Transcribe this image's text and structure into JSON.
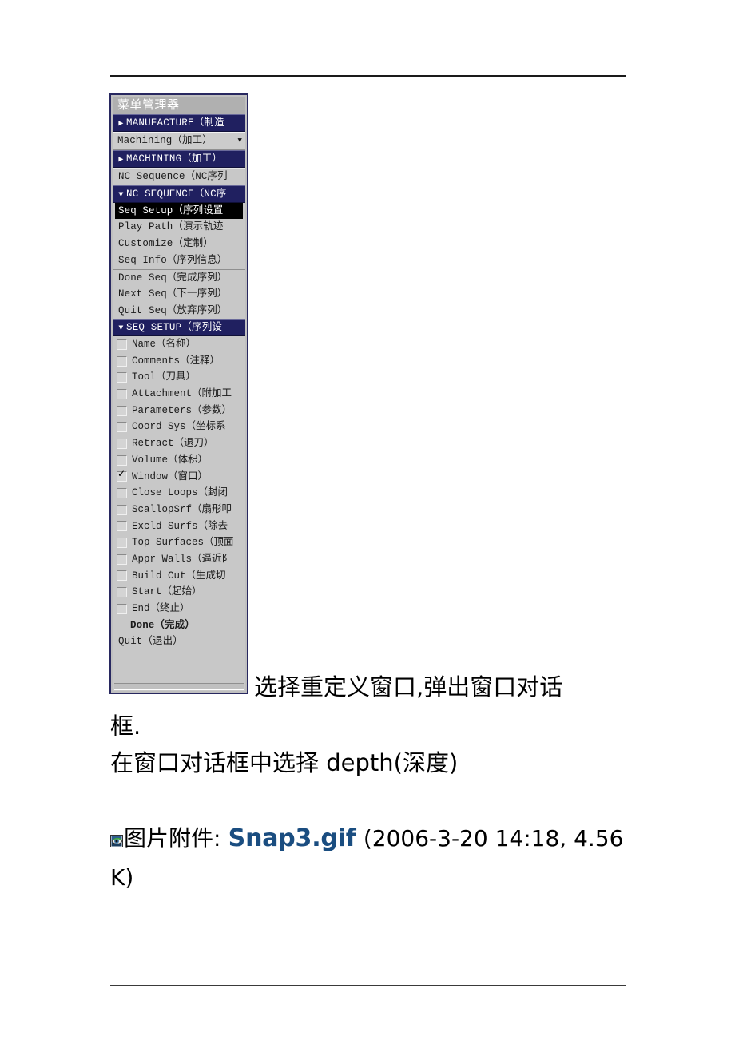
{
  "page": {
    "rule_top": "",
    "rule_bottom": ""
  },
  "menu_manager": {
    "title": "菜单管理器",
    "rows": [
      {
        "kind": "section",
        "arrow": "right-arrow-icon",
        "glyph": "▶",
        "label": "MANUFACTURE（制造"
      },
      {
        "kind": "dropdown",
        "label": "Machining（加工）",
        "caret": "▼"
      },
      {
        "kind": "section",
        "arrow": "right-arrow-icon",
        "glyph": "▶",
        "label": "MACHINING（加工）"
      },
      {
        "kind": "plain",
        "label": "NC Sequence（NC序列"
      },
      {
        "kind": "section",
        "arrow": "down-arrow-icon",
        "glyph": "▼",
        "label": "NC SEQUENCE（NC序"
      },
      {
        "kind": "selected",
        "label": "Seq Setup（序列设置"
      },
      {
        "kind": "item",
        "label": "Play Path（演示轨迹"
      },
      {
        "kind": "item",
        "label": "Customize（定制）"
      },
      {
        "kind": "item_sep",
        "label": "Seq Info（序列信息）"
      },
      {
        "kind": "item_sep",
        "label": "Done Seq（完成序列）"
      },
      {
        "kind": "item",
        "label": "Next Seq（下一序列）"
      },
      {
        "kind": "item",
        "label": "Quit Seq（放弃序列）"
      },
      {
        "kind": "section",
        "arrow": "down-arrow-icon",
        "glyph": "▼",
        "label": "SEQ SETUP（序列设"
      },
      {
        "kind": "check",
        "checked": false,
        "label": "Name（名称）"
      },
      {
        "kind": "check",
        "checked": false,
        "label": "Comments（注释）"
      },
      {
        "kind": "check",
        "checked": false,
        "label": "Tool（刀具）"
      },
      {
        "kind": "check",
        "checked": false,
        "label": "Attachment（附加工"
      },
      {
        "kind": "check",
        "checked": false,
        "label": "Parameters（参数）"
      },
      {
        "kind": "check",
        "checked": false,
        "label": "Coord Sys（坐标系"
      },
      {
        "kind": "check",
        "checked": false,
        "label": "Retract（退刀）"
      },
      {
        "kind": "check",
        "checked": false,
        "label": "Volume（体积）"
      },
      {
        "kind": "check",
        "checked": true,
        "label": "Window（窗口）"
      },
      {
        "kind": "check",
        "checked": false,
        "label": "Close Loops（封闭"
      },
      {
        "kind": "check",
        "checked": false,
        "label": "ScallopSrf（扇形叩"
      },
      {
        "kind": "check",
        "checked": false,
        "label": "Excld Surfs（除去"
      },
      {
        "kind": "check",
        "checked": false,
        "label": "Top Surfaces（顶面"
      },
      {
        "kind": "check",
        "checked": false,
        "label": "Appr Walls（逼近阝"
      },
      {
        "kind": "check",
        "checked": false,
        "label": "Build Cut（生成切"
      },
      {
        "kind": "check",
        "checked": false,
        "label": "Start（起始）"
      },
      {
        "kind": "check",
        "checked": false,
        "label": "End（终止）"
      },
      {
        "kind": "done",
        "label": "Done（完成）"
      },
      {
        "kind": "item",
        "label": "Quit（退出）"
      }
    ]
  },
  "body": {
    "paragraph1_run1": "选择重定义窗口,弹出窗口对话",
    "paragraph1_run2": "框.",
    "paragraph2": "在窗口对话框中选择 depth(深度)"
  },
  "attachment": {
    "icon": "image-attachment-icon",
    "label": "图片附件:",
    "filename": "Snap3.gif",
    "meta": "(2006-3-20  14:18, 4.56 K)"
  },
  "colors": {
    "section_bg": "#202060",
    "window_bg": "#c8c8c8",
    "window_border": "#282860",
    "selected_bg": "#000000",
    "link_blue": "#1a4d80"
  }
}
